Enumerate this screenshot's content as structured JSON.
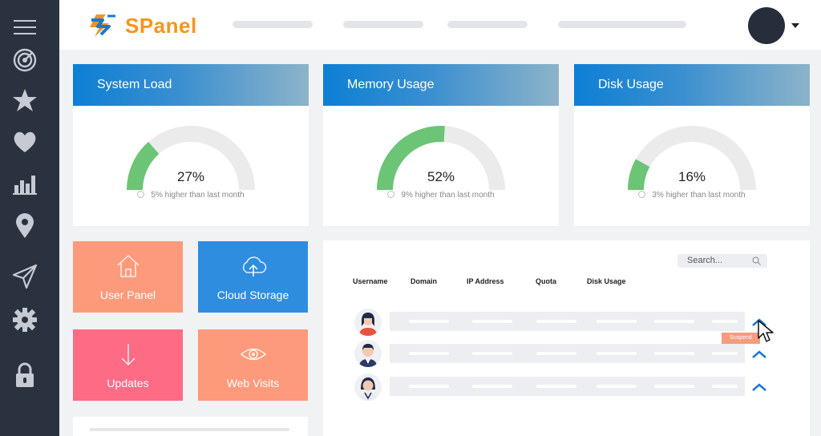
{
  "app": {
    "logo_text": "SPanel"
  },
  "colors": {
    "sidebar_bg": "#2b323f",
    "accent_orange": "#f7941d",
    "accent_blue": "#0d7fd4",
    "gauge_fill": "#6cc476",
    "gauge_track": "#ebebeb"
  },
  "sidebar": {
    "items": [
      {
        "icon": "menu-icon"
      },
      {
        "icon": "radar-icon"
      },
      {
        "icon": "star-icon"
      },
      {
        "icon": "heart-icon"
      },
      {
        "icon": "bar-chart-icon"
      },
      {
        "icon": "map-pin-icon"
      },
      {
        "icon": "send-icon"
      },
      {
        "icon": "gear-icon"
      },
      {
        "icon": "lock-icon"
      }
    ]
  },
  "cards": [
    {
      "title": "System Load",
      "percent_label": "27%",
      "percent": 27,
      "note": "5% higher than last month"
    },
    {
      "title": "Memory Usage",
      "percent_label": "52%",
      "percent": 52,
      "note": "9% higher than last month"
    },
    {
      "title": "Disk Usage",
      "percent_label": "16%",
      "percent": 16,
      "note": "3% higher than last month"
    }
  ],
  "tiles": [
    {
      "label": "User Panel",
      "icon": "home-icon",
      "color": "#fd9a7b"
    },
    {
      "label": "Cloud Storage",
      "icon": "cloud-upload-icon",
      "color": "#2f8de0"
    },
    {
      "label": "Updates",
      "icon": "arrow-down-icon",
      "color": "#fd6b85"
    },
    {
      "label": "Web Visits",
      "icon": "eye-icon",
      "color": "#fd9a7b"
    }
  ],
  "table": {
    "search_placeholder": "Search...",
    "columns": [
      "Username",
      "Domain",
      "IP Address",
      "Quota",
      "Disk Usage"
    ],
    "rows": [
      {
        "avatar": "user-avatar-1"
      },
      {
        "avatar": "user-avatar-2"
      },
      {
        "avatar": "user-avatar-3"
      }
    ],
    "tooltip": "Suspend"
  }
}
